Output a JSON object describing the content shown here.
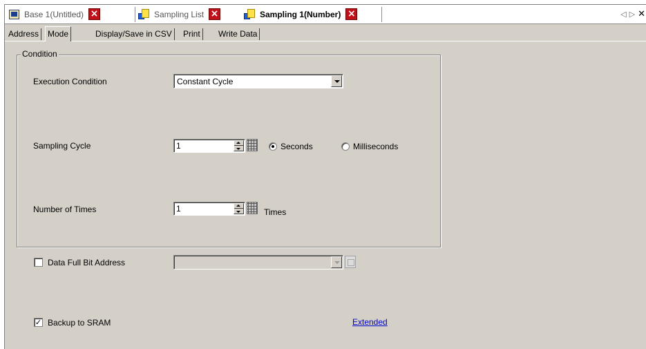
{
  "doc_tabs": [
    {
      "label": "Base 1(Untitled)",
      "icon": "monitor-icon"
    },
    {
      "label": "Sampling List",
      "icon": "sheet-icon"
    },
    {
      "label": "Sampling 1(Number)",
      "icon": "sheet-icon",
      "active": true
    }
  ],
  "prop_tabs": [
    "Address",
    "Mode",
    "Display/Save in CSV",
    "Print",
    "Write Data"
  ],
  "active_prop_tab": "Mode",
  "condition": {
    "group_title": "Condition",
    "execution_label": "Execution Condition",
    "execution_value": "Constant Cycle",
    "cycle_label": "Sampling Cycle",
    "cycle_value": "1",
    "unit_seconds": "Seconds",
    "unit_milliseconds": "Milliseconds",
    "selected_unit": "Seconds",
    "times_label": "Number of Times",
    "times_value": "1",
    "times_unit": "Times"
  },
  "data_full": {
    "label": "Data Full Bit Address",
    "checked": false,
    "value": ""
  },
  "backup": {
    "label": "Backup to SRAM",
    "checked": true
  },
  "extended_link": "Extended",
  "colors": {
    "panel": "#d4d0c8",
    "close_button": "#c0101a",
    "link": "#0000cc"
  }
}
